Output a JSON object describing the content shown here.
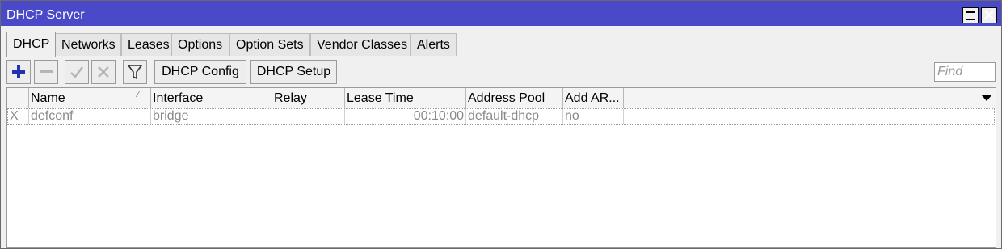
{
  "window": {
    "title": "DHCP Server"
  },
  "tabs": [
    {
      "label": "DHCP"
    },
    {
      "label": "Networks"
    },
    {
      "label": "Leases"
    },
    {
      "label": "Options"
    },
    {
      "label": "Option Sets"
    },
    {
      "label": "Vendor Classes"
    },
    {
      "label": "Alerts"
    }
  ],
  "toolbar": {
    "add_icon": "plus-icon",
    "remove_icon": "minus-icon",
    "enable_icon": "check-icon",
    "disable_icon": "cross-icon",
    "filter_icon": "filter-icon",
    "dhcp_config_label": "DHCP Config",
    "dhcp_setup_label": "DHCP Setup",
    "find_placeholder": "Find"
  },
  "table": {
    "columns": [
      "",
      "Name",
      "Interface",
      "Relay",
      "Lease Time",
      "Address Pool",
      "Add AR..."
    ],
    "sorted_column": "Name",
    "rows": [
      {
        "flag": "X",
        "name": "defconf",
        "interface": "bridge",
        "relay": "",
        "lease_time": "00:10:00",
        "address_pool": "default-dhcp",
        "add_arp": "no",
        "status": "disabled"
      }
    ]
  },
  "colors": {
    "titlebar": "#4a4ac9",
    "add_icon": "#1f32b0",
    "disabled_text": "#8a8a8a"
  }
}
